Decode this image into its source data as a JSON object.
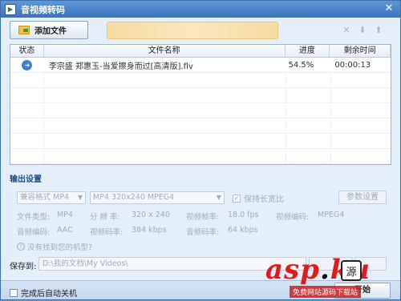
{
  "window": {
    "title": "音视频转码",
    "close_glyph": "✕"
  },
  "toolbar": {
    "add_file_label": "添加文件",
    "icons": [
      "delete-icon",
      "move-down-icon",
      "move-up-icon"
    ]
  },
  "file_list": {
    "columns": [
      "状态",
      "文件名称",
      "进度",
      "剩余时间"
    ],
    "rows": [
      {
        "status_icon": "play-icon",
        "name": "李宗盛 郑惠玉-当爱擦身而过[高清版].flv",
        "progress": "54.5%",
        "remaining": "00:00:13"
      }
    ]
  },
  "output": {
    "section_title": "输出设置",
    "format_select": "兼容格式 MP4",
    "preset_select": "MP4 320x240 MPEG4",
    "keep_ratio_label": "保持长宽比",
    "keep_ratio_checked": true,
    "params_button": "参数设置",
    "info": {
      "file_type_label": "文件类型:",
      "file_type_value": "MP4",
      "resolution_label": "分 辨 率:",
      "resolution_value": "320 x 240",
      "framerate_label": "视频帧率:",
      "framerate_value": "18.0 fps",
      "video_codec_label": "视频编码:",
      "video_codec_value": "MPEG4",
      "audio_codec_label": "音频编码:",
      "audio_codec_value": "AAC",
      "video_bitrate_label": "视频码率:",
      "video_bitrate_value": "384 kbps",
      "audio_bitrate_label": "音频码率:",
      "audio_bitrate_value": "64 kbps"
    },
    "help_text": "没有找到您的机型?"
  },
  "save": {
    "label": "保存到:",
    "path": "D:\\我的文档\\My Videos\\"
  },
  "footer": {
    "shutdown_label": "完成后自动关机",
    "start_button": "开始"
  },
  "watermark": {
    "brand": "asp",
    "brand_dot": ".",
    "brand_tail": "ku",
    "seal": "源",
    "sub": "免费网站源码下载站"
  }
}
